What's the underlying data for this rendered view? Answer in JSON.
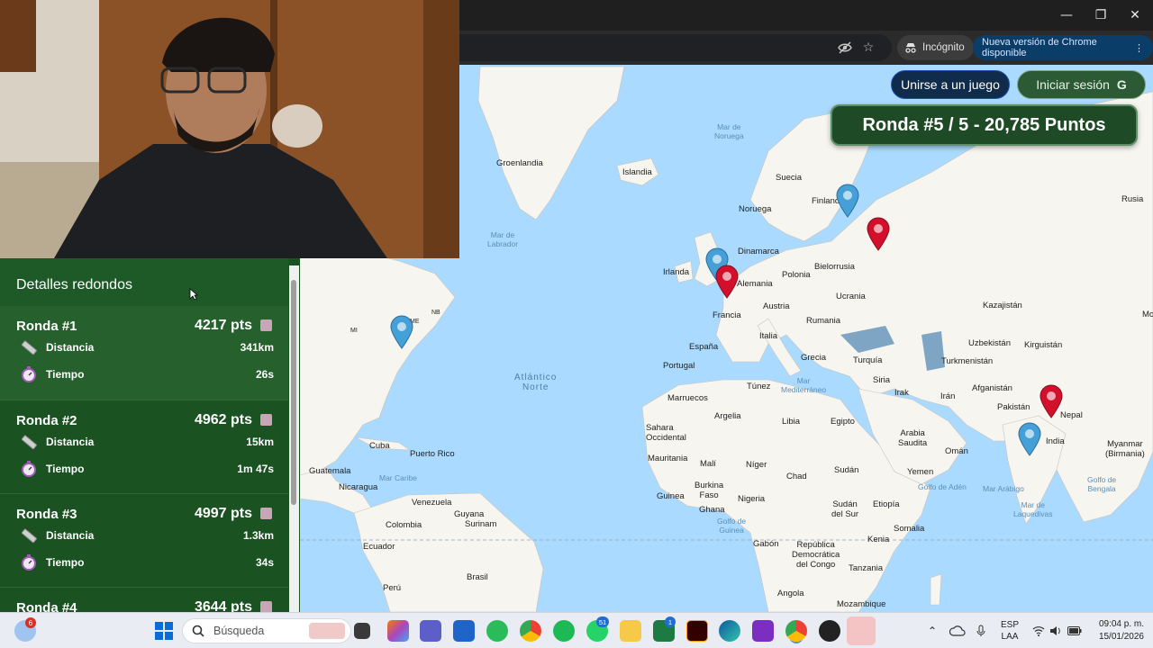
{
  "browser": {
    "minimize": "—",
    "restore": "❐",
    "close": "✕",
    "incognito_label": "Incógnito",
    "update_label": "Nueva versión de Chrome disponible",
    "more": "⋮"
  },
  "game": {
    "join_label": "Unirse a un juego",
    "login_label": "Iniciar sesión",
    "login_icon": "G",
    "round_banner": "Ronda #5 / 5 - 20,785 Puntos"
  },
  "map_labels": {
    "greenland": "Groenlandia",
    "iceland": "Islandia",
    "norway_sea": "Mar de\nNoruega",
    "sweden": "Suecia",
    "finland": "Finlandia",
    "norway": "Noruega",
    "russia": "Rusia",
    "labrador": "Mar de\nLabrador",
    "denmark": "Dinamarca",
    "ireland": "Irlanda",
    "belarus": "Bielorrusia",
    "poland": "Polonia",
    "germany": "Alemania",
    "ukraine": "Ucrania",
    "france": "Francia",
    "austria": "Austria",
    "romania": "Rumania",
    "kazakhstan": "Kazajistán",
    "italy": "Italia",
    "spain": "España",
    "uzbekistan": "Uzbekistán",
    "kyrgyzstan": "Kirguistán",
    "turkmenistan": "Turkmenistán",
    "portugal": "Portugal",
    "greece": "Grecia",
    "turkey": "Turquía",
    "atlantic": "Atlántico\nNorte",
    "tunisia": "Túnez",
    "med_sea": "Mar\nMediterráneo",
    "syria": "Siria",
    "afghanistan": "Afganistán",
    "iraq": "Irak",
    "iran": "Irán",
    "morocco": "Marruecos",
    "algeria": "Argelia",
    "libya": "Libia",
    "egypt": "Egipto",
    "pakistan": "Pakistán",
    "nepal": "Nepal",
    "western_sahara": "Sahara\nOccidental",
    "saudi": "Arabia\nSaudita",
    "india": "India",
    "cuba": "Cuba",
    "oman": "Omán",
    "myanmar": "Myanmar\n(Birmania)",
    "puerto_rico": "Puerto Rico",
    "mauritania": "Mauritania",
    "mali": "Malí",
    "niger": "Níger",
    "chad": "Chad",
    "sudan": "Sudán",
    "yemen": "Yemen",
    "guatemala": "Guatemala",
    "caribbean": "Mar Caribe",
    "gulf_aden": "Golfo de Adén",
    "arabian_sea": "Mar Arábigo",
    "bengal": "Golfo de\nBengala",
    "nicaragua": "Nicaragua",
    "guinea": "Guinea",
    "burkina": "Burkina\nFaso",
    "nigeria": "Nigeria",
    "south_sudan": "Sudán\ndel Sur",
    "ethiopia": "Etiopía",
    "laccadive": "Mar de\nLaquedivas",
    "venezuela": "Venezuela",
    "guyana": "Guyana",
    "suriname": "Surinam",
    "ghana": "Ghana",
    "gulf_guinea": "Golfo de\nGuinea",
    "colombia": "Colombia",
    "somalia": "Somalia",
    "ecuador": "Ecuador",
    "gabon": "Gabón",
    "drc": "República\nDemocrática\ndel Congo",
    "kenya": "Kenia",
    "brazil": "Brasil",
    "peru": "Perú",
    "tanzania": "Tanzania",
    "angola": "Angola",
    "mozambique": "Mozambique",
    "nb": "NB",
    "me": "ME",
    "mi": "MI",
    "mo": "Mo"
  },
  "panel": {
    "title": "Detalles redondos",
    "rounds": [
      {
        "title": "Ronda #1",
        "points": "4217 pts",
        "distance_label": "Distancia",
        "distance": "341km",
        "time_label": "Tiempo",
        "time": "26s"
      },
      {
        "title": "Ronda #2",
        "points": "4962 pts",
        "distance_label": "Distancia",
        "distance": "15km",
        "time_label": "Tiempo",
        "time": "1m 47s"
      },
      {
        "title": "Ronda #3",
        "points": "4997 pts",
        "distance_label": "Distancia",
        "distance": "1.3km",
        "time_label": "Tiempo",
        "time": "34s"
      },
      {
        "title": "Ronda #4",
        "points": "3644 pts"
      }
    ]
  },
  "taskbar": {
    "weather_badge": "6",
    "search_placeholder": "Búsqueda",
    "whatsapp_badge": "51",
    "excel_badge": "1",
    "lang_top": "ESP",
    "lang_bottom": "LAA",
    "time": "09:04 p. m.",
    "date": "15/01/2026"
  },
  "colors": {
    "panel_green": "#1a5222",
    "banner_green": "#1f4a26",
    "guess_pin": "#46a0d8",
    "answer_pin": "#d3102c",
    "join_blue": "#102c4a"
  }
}
